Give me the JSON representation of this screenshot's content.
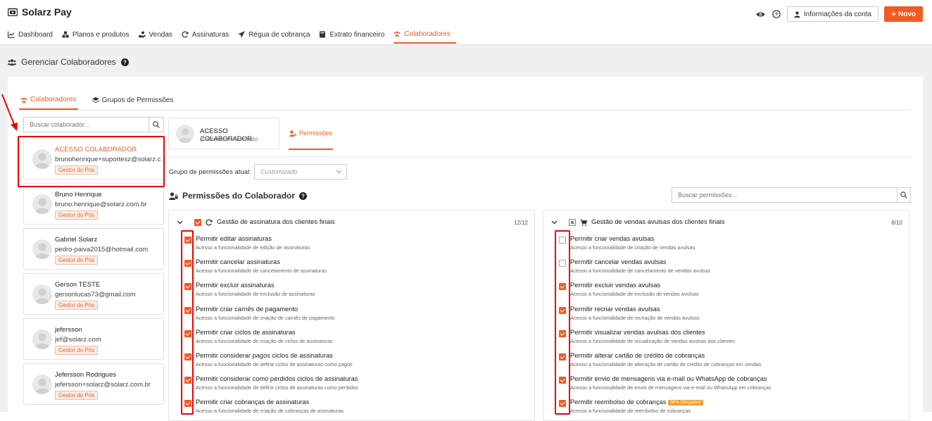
{
  "app": {
    "name": "Solarz Pay"
  },
  "nav": [
    {
      "id": "dashboard",
      "label": "Dashboard",
      "icon": "chart-icon"
    },
    {
      "id": "planos",
      "label": "Planos e produtos",
      "icon": "boxes-icon"
    },
    {
      "id": "vendas",
      "label": "Vendas",
      "icon": "hand-icon"
    },
    {
      "id": "assinaturas",
      "label": "Assinaturas",
      "icon": "refresh-icon"
    },
    {
      "id": "regua",
      "label": "Régua de cobrança",
      "icon": "send-icon"
    },
    {
      "id": "extrato",
      "label": "Extrato financeiro",
      "icon": "book-icon"
    },
    {
      "id": "colaboradores",
      "label": "Colaboradores",
      "icon": "users-icon",
      "active": true
    }
  ],
  "header_actions": {
    "account_label": "Informações da conta",
    "new_label": "Novo"
  },
  "page": {
    "title": "Gerenciar Colaboradores"
  },
  "tabs": {
    "colaboradores": "Colaboradores",
    "grupos": "Grupos de Permissões"
  },
  "search": {
    "placeholder": "Buscar colaborador..."
  },
  "collaborators": [
    {
      "name": "ACESSO COLABORADOR",
      "email": "brunohenrique+suportesz@solarz.com.br",
      "badge": "Gestor do Pós",
      "selected": true
    },
    {
      "name": "Bruno Henrique",
      "email": "bruno.henrique@solarz.com.br",
      "badge": "Gestor do Pós"
    },
    {
      "name": "Gabriel Solarz",
      "email": "pedro-paiva2015@hotmail.com",
      "badge": "Gestor do Pós"
    },
    {
      "name": "Gerson TESTE",
      "email": "gersonlucas73@gmail.com",
      "badge": "Gestor do Pós"
    },
    {
      "name": "jefersson",
      "email": "jef@solarz.com",
      "badge": "Gestor do Pós"
    },
    {
      "name": "Jefersson Rodrigues",
      "email": "jefersson+solarz@solarz.com.br",
      "badge": "Gestor do Pós"
    }
  ],
  "selected": {
    "name": "ACESSO COLABORADOR",
    "subtitle": "(Colaborador selecionado)",
    "tab_label": "Permissões"
  },
  "permission_group": {
    "label": "Grupo de permissões atual:",
    "value": "Customizado"
  },
  "permissions": {
    "title": "Permissões do Colaborador",
    "search_placeholder": "Buscar permissões...",
    "panels": [
      {
        "title": "Gestão de assinatura dos clientes finais",
        "count": "12/12",
        "state": "on",
        "items": [
          {
            "label": "Permitir editar assinaturas",
            "desc": "Acesso a funcionalidade de edição de assinaturas",
            "checked": true
          },
          {
            "label": "Permitir cancelar assinaturas",
            "desc": "Acesso a funcionalidade de cancelamento de assinaturas",
            "checked": true
          },
          {
            "label": "Permitir excluir assinaturas",
            "desc": "Acesso a funcionalidade de exclusão de assinaturas",
            "checked": true
          },
          {
            "label": "Permitir criar carnês de pagamento",
            "desc": "Acesso a funcionalidade de criação de carnês de pagamento",
            "checked": true
          },
          {
            "label": "Permitir criar ciclos de assinaturas",
            "desc": "Acesso a funcionalidade de criação de ciclos de assinaturas",
            "checked": true
          },
          {
            "label": "Permitir considerar pagos ciclos de assinaturas",
            "desc": "Acesso a funcionalidade de definir ciclos de assinaturas como pagos",
            "checked": true
          },
          {
            "label": "Permitir considerar como perdidos ciclos de assinaturas",
            "desc": "Acesso a funcionalidade de definir ciclos de assinaturas como perdidos",
            "checked": true
          },
          {
            "label": "Permitir criar cobranças de assinaturas",
            "desc": "Acesso a funcionalidade de criação de cobranças de assinaturas",
            "checked": true
          }
        ]
      },
      {
        "title": "Gestão de vendas avulsas dos clientes finais",
        "count": "8/10",
        "state": "partial",
        "items": [
          {
            "label": "Permitir criar vendas avulsas",
            "desc": "Acesso a funcionalidade de criação de vendas avulsas",
            "checked": false
          },
          {
            "label": "Permitir cancelar vendas avulsas",
            "desc": "Acesso a funcionalidade de cancelamento de vendas avulsas",
            "checked": false
          },
          {
            "label": "Permitir excluir vendas avulsas",
            "desc": "Acesso a funcionalidade de exclusão de vendas avulsas",
            "checked": true
          },
          {
            "label": "Permitir recriar vendas avulsas",
            "desc": "Acesso a funcionalidade de recriação de vendas avulsas",
            "checked": true
          },
          {
            "label": "Permitir visualizar vendas avulsas dos clientes",
            "desc": "Acesso a funcionalidade de visualização de vendas avulsas dos clientes",
            "checked": true
          },
          {
            "label": "Permitir alterar cartão de crédito de cobranças",
            "desc": "Acesso a funcionalidade de alteração de cartão de crédito de cobranças em vendas",
            "checked": true
          },
          {
            "label": "Permitir envio de mensagens via e-mail ou WhatsApp de cobranças",
            "desc": "Acesso a funcionalidade de envio de mensagens via e-mail ou WhatsApp em cobranças",
            "checked": true
          },
          {
            "label": "Permitir reembolso de cobranças",
            "desc": "Acesso a funcionalidade de reembolso de cobranças",
            "checked": true,
            "badge": "MFA Obrigatório"
          }
        ]
      }
    ]
  },
  "colors": {
    "accent": "#f15a24",
    "highlight": "#ee0000"
  }
}
